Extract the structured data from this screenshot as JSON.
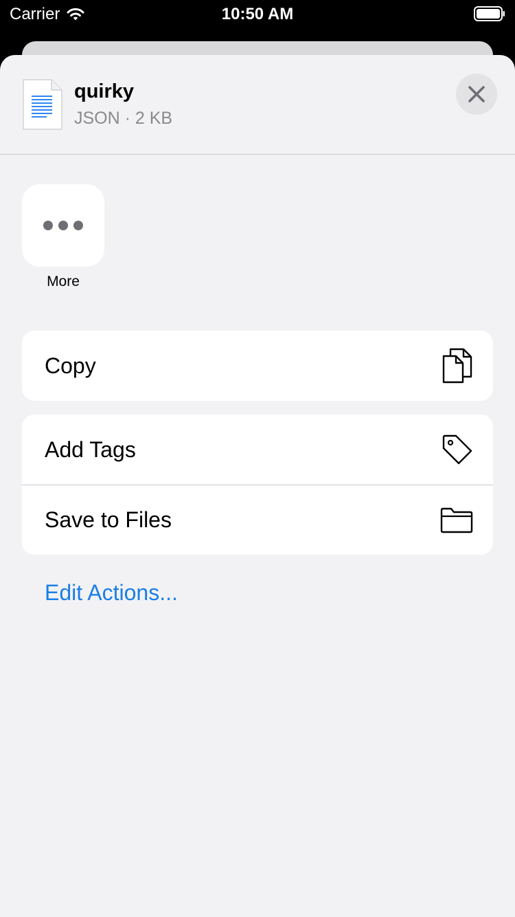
{
  "status_bar": {
    "carrier": "Carrier",
    "time": "10:50 AM",
    "wifi_icon": "wifi-icon",
    "battery_icon": "battery-icon"
  },
  "share_sheet": {
    "file": {
      "name": "quirky",
      "meta": "JSON · 2 KB",
      "icon": "document-icon"
    },
    "close_icon": "close-icon",
    "apps": [
      {
        "label": "More",
        "icon": "ellipsis-icon"
      }
    ],
    "action_groups": [
      [
        {
          "label": "Copy",
          "icon": "copy-icon"
        }
      ],
      [
        {
          "label": "Add Tags",
          "icon": "tag-icon"
        },
        {
          "label": "Save to Files",
          "icon": "folder-icon"
        }
      ]
    ],
    "edit_actions_label": "Edit Actions..."
  },
  "colors": {
    "accent": "#1a7fe6",
    "sheet_background": "#f2f2f4",
    "card_background": "#ffffff",
    "secondary_text": "#8a8a8e"
  }
}
